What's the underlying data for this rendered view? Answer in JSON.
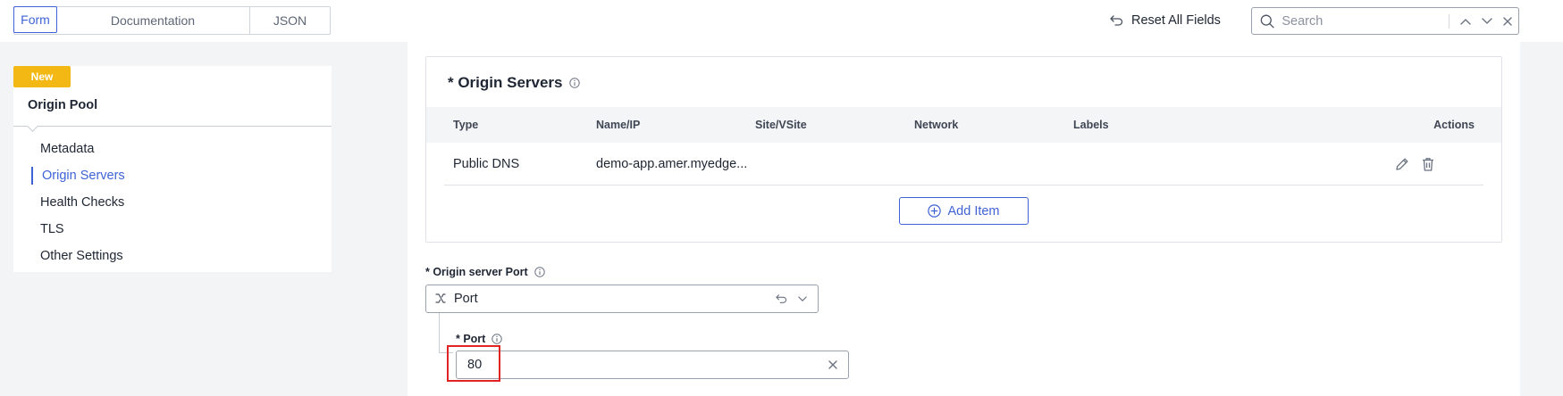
{
  "topbar": {
    "tabs": [
      {
        "label": "Form",
        "active": true
      },
      {
        "label": "Documentation",
        "active": false
      },
      {
        "label": "JSON",
        "active": false
      }
    ],
    "reset_label": "Reset All Fields",
    "search_placeholder": "Search"
  },
  "leftnav": {
    "badge": "New",
    "title": "Origin Pool",
    "items": [
      {
        "label": "Metadata",
        "active": false
      },
      {
        "label": "Origin Servers",
        "active": true
      },
      {
        "label": "Health Checks",
        "active": false
      },
      {
        "label": "TLS",
        "active": false
      },
      {
        "label": "Other Settings",
        "active": false
      }
    ]
  },
  "origin_servers": {
    "title": "* Origin Servers",
    "columns": [
      "Type",
      "Name/IP",
      "Site/VSite",
      "Network",
      "Labels",
      "Actions"
    ],
    "rows": [
      {
        "type": "Public DNS",
        "name_ip": "demo-app.amer.myedge...",
        "site": "",
        "network": "",
        "labels": ""
      }
    ],
    "add_item_label": "Add Item"
  },
  "port_field": {
    "label": "* Origin server Port",
    "selected": "Port",
    "sub_label": "* Port",
    "value": "80"
  },
  "colors": {
    "accent": "#3f63d6",
    "badge": "#f3b814",
    "highlight": "#e02424"
  }
}
